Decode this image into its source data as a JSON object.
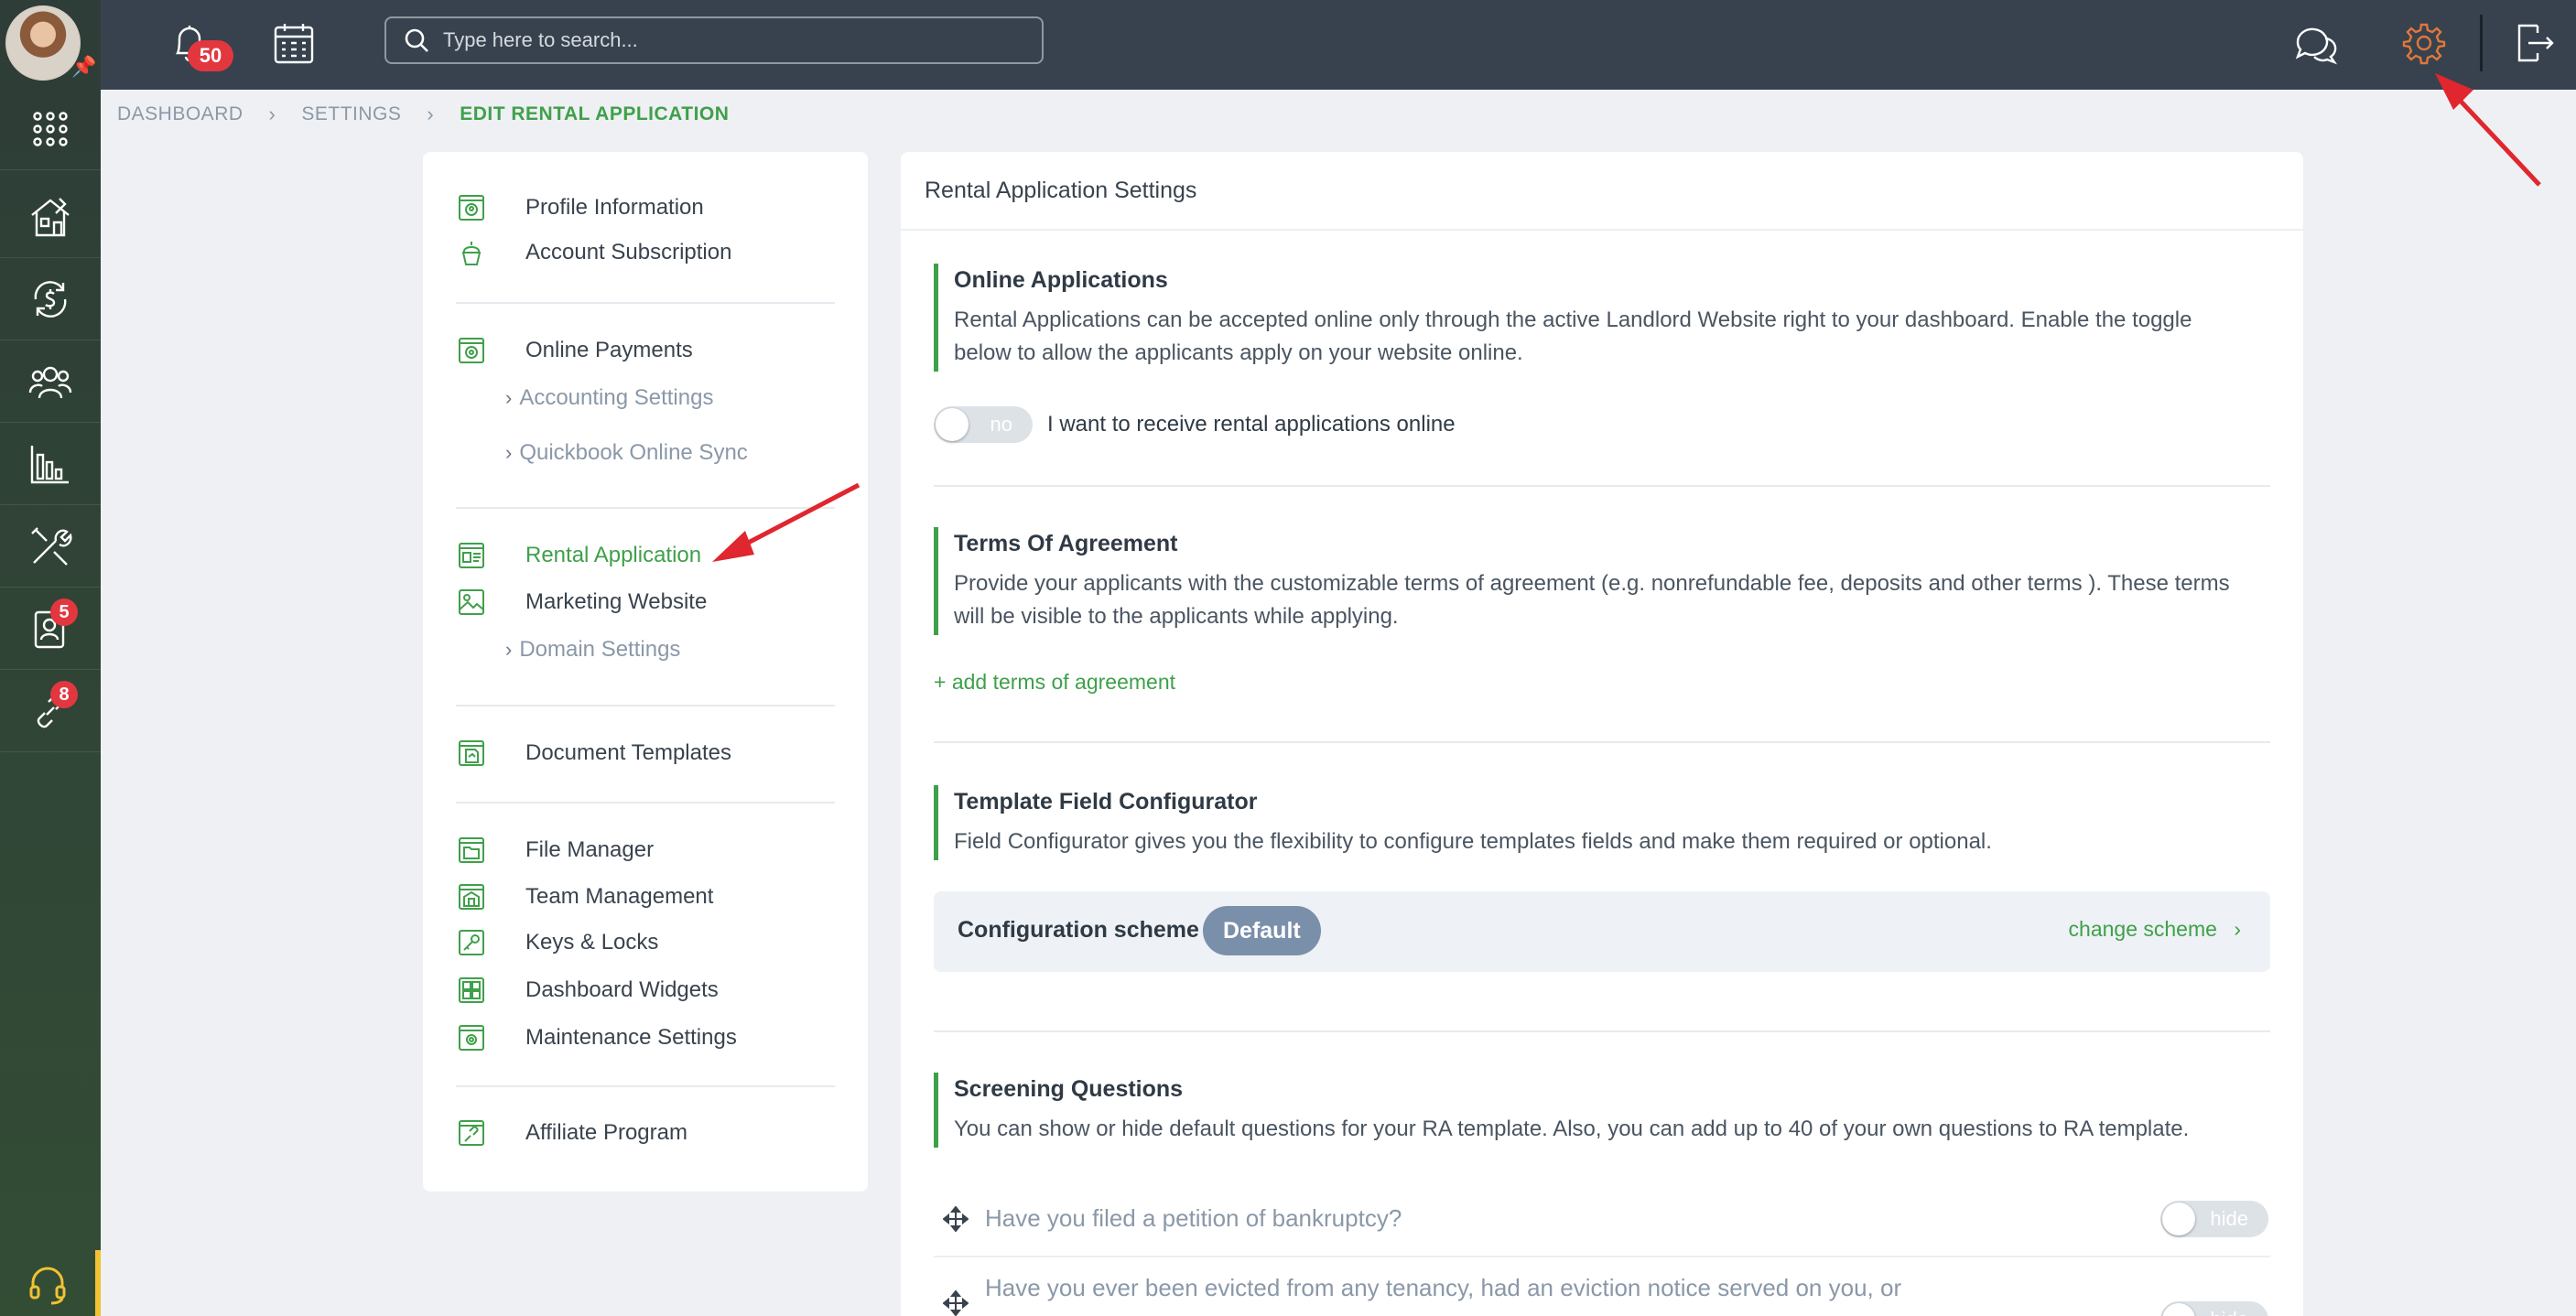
{
  "header": {
    "notifications_count": "50",
    "search_placeholder": "Type here to search..."
  },
  "sidebar": {
    "badges": {
      "tenants": "5",
      "affiliate": "8"
    }
  },
  "breadcrumb": [
    "DASHBOARD",
    "SETTINGS",
    "EDIT RENTAL APPLICATION"
  ],
  "settings_menu": {
    "profile": "Profile Information",
    "subscription": "Account Subscription",
    "online_payments": "Online Payments",
    "accounting": "Accounting Settings",
    "quickbook": "Quickbook Online Sync",
    "rental_application": "Rental Application",
    "marketing_website": "Marketing Website",
    "domain_settings": "Domain Settings",
    "document_templates": "Document Templates",
    "file_manager": "File Manager",
    "team_management": "Team Management",
    "keys_locks": "Keys & Locks",
    "dashboard_widgets": "Dashboard Widgets",
    "maintenance_settings": "Maintenance Settings",
    "affiliate_program": "Affiliate Program"
  },
  "main": {
    "title": "Rental Application Settings",
    "online": {
      "title": "Online Applications",
      "desc": "Rental Applications can be accepted online only through the active Landlord Website right to your dashboard. Enable the toggle below to allow the applicants apply on your website online.",
      "toggle_text": "no",
      "toggle_label": "I want to receive rental applications online"
    },
    "terms": {
      "title": "Terms Of Agreement",
      "desc": "Provide your applicants with the customizable terms of agreement (e.g. nonrefundable fee, deposits and other terms ). These terms will be visible to the applicants while applying.",
      "add_link": "+ add terms of agreement"
    },
    "template": {
      "title": "Template Field Configurator",
      "desc": "Field Configurator gives you the flexibility to configure templates fields and make them required or optional.",
      "scheme_label": "Configuration scheme",
      "scheme_value": "Default",
      "change_link": "change scheme"
    },
    "screening": {
      "title": "Screening Questions",
      "desc": "You can show or hide default questions for your RA template. Also, you can add up to 40 of your own questions to RA template.",
      "questions": [
        {
          "text": "Have you filed a petition of bankruptcy?",
          "toggle": "hide"
        },
        {
          "text": "Have you ever been evicted from any tenancy, had an eviction notice served on you, or",
          "toggle": "hide"
        }
      ]
    }
  }
}
